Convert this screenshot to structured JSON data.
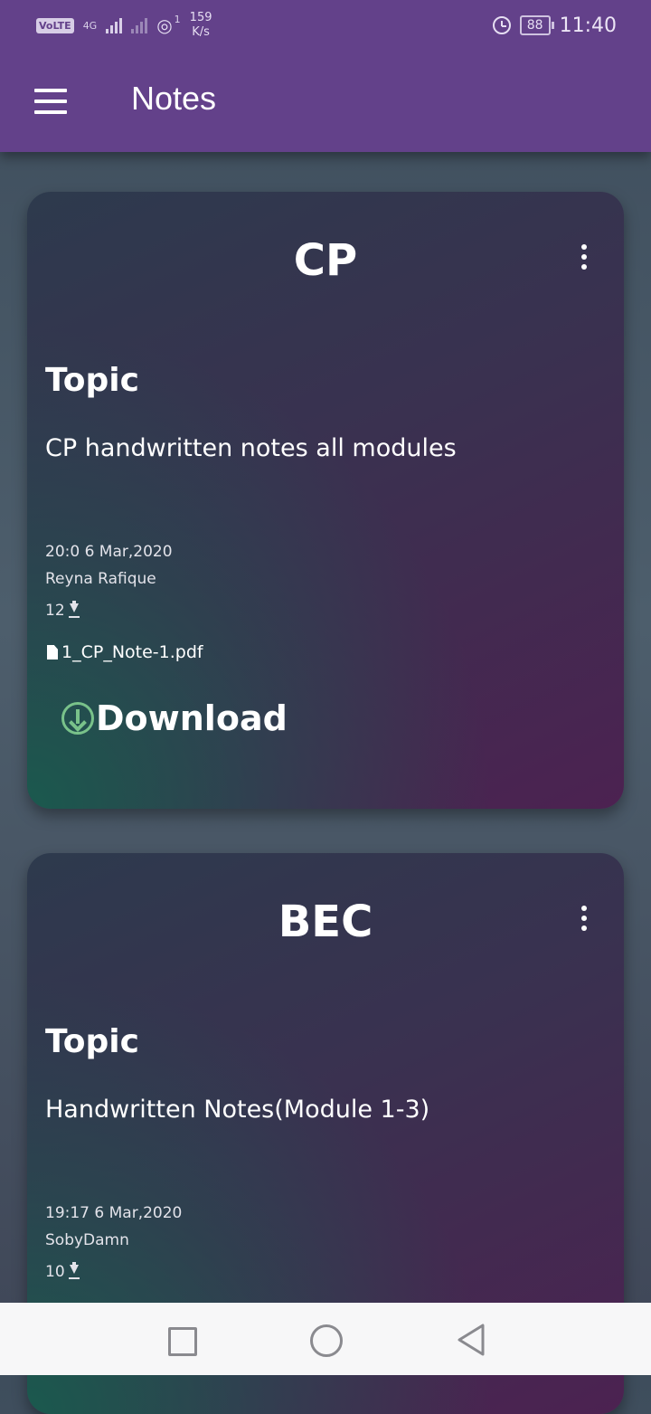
{
  "status_bar": {
    "network_label": "VoLTE",
    "net_type": "4G",
    "hotspot_count": "1",
    "speed_value": "159",
    "speed_unit": "K/s",
    "battery": "88",
    "time": "11:40"
  },
  "app_bar": {
    "title": "Notes"
  },
  "notes": [
    {
      "subject": "CP",
      "topic_label": "Topic",
      "topic": "CP handwritten notes all modules",
      "timestamp": "20:0 6 Mar,2020",
      "author": "Reyna Rafique",
      "downloads": "12",
      "file_name": "1_CP_Note-1.pdf",
      "download_label": "Download"
    },
    {
      "subject": "BEC",
      "topic_label": "Topic",
      "topic": "Handwritten Notes(Module 1-3)",
      "timestamp": "19:17 6 Mar,2020",
      "author": "SobyDamn",
      "downloads": "10"
    }
  ],
  "colors": {
    "app_bar": "#63418a",
    "download_icon": "#79c28a"
  }
}
